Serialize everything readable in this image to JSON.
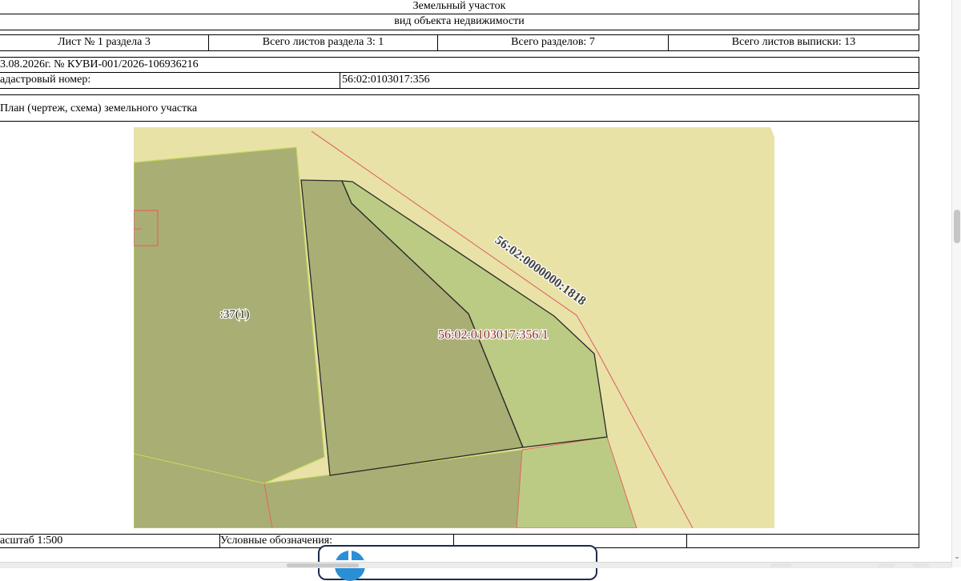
{
  "header": {
    "object_title": "Земельный участок",
    "object_subtitle": "вид объекта недвижимости"
  },
  "sheet_info": {
    "sheet": "Лист № 1 раздела 3",
    "sheets_in_section": "Всего листов раздела 3: 1",
    "sections_total": "Всего разделов: 7",
    "sheets_total": "Всего листов выписки: 13"
  },
  "document": {
    "date_number": "3.08.2026г. № КУВИ-001/2026-106936216",
    "cadastral_label": "адастровый номер:",
    "cadastral_value": "56:02:0103017:356"
  },
  "plan": {
    "title": "План (чертеж, схема) земельного участка",
    "labels": {
      "parcel_37": ":37(1)",
      "parcel_356_1": "56:02:0103017:356/1",
      "parcel_1818": "56:02:0000000:1818"
    }
  },
  "footer": {
    "scale": "асштаб 1:500",
    "legend": "Условные обозначения:",
    "legend_col2": "",
    "legend_col3": ""
  },
  "colors": {
    "map_background": "#e8e2a7",
    "parcel_dark": "#a9ae74",
    "parcel_green": "#bccb83",
    "boundary_red": "#e06565",
    "border_yellow": "#c6d65a",
    "float_panel_border": "#1d2a4d",
    "float_logo": "#2a8fd6"
  }
}
